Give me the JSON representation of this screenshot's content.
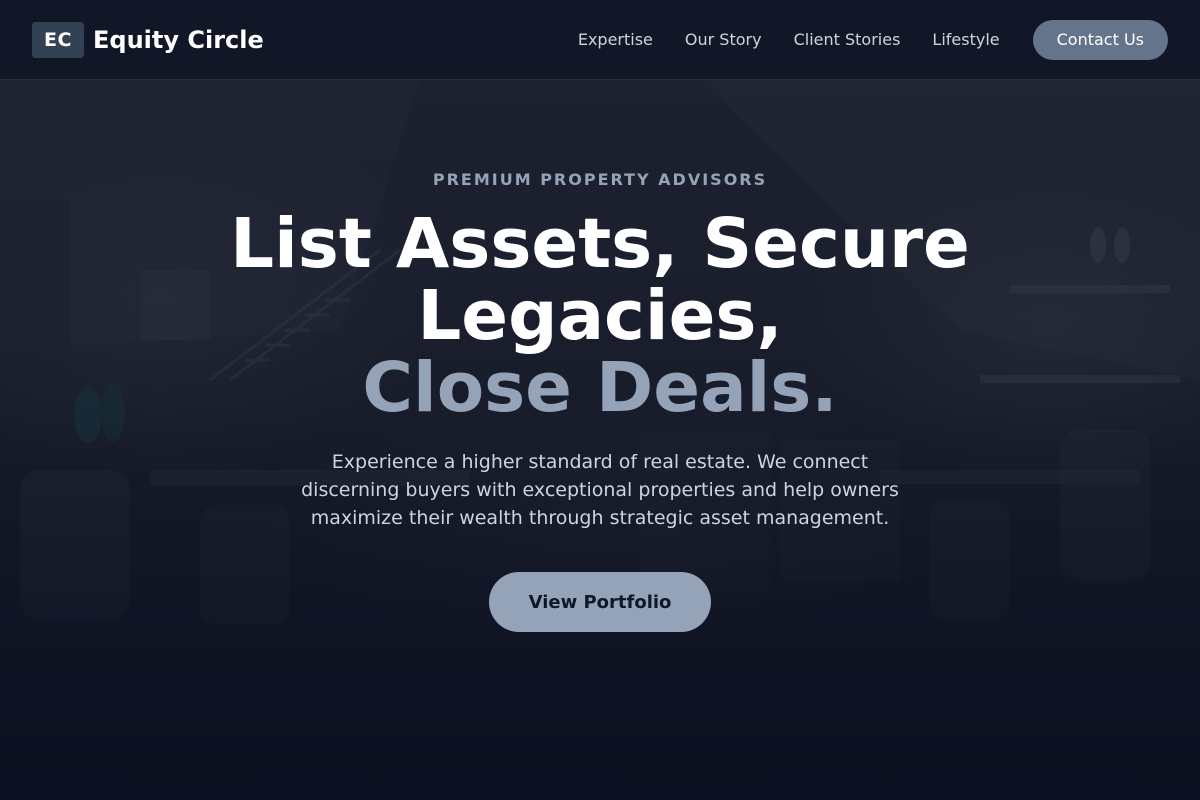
{
  "brand": {
    "badge": "EC",
    "name": "Equity Circle"
  },
  "nav": {
    "links": [
      "Expertise",
      "Our Story",
      "Client Stories",
      "Lifestyle"
    ],
    "contact_label": "Contact Us"
  },
  "hero": {
    "eyebrow": "PREMIUM PROPERTY ADVISORS",
    "headline_line1": "List Assets, Secure",
    "headline_line2": "Legacies,",
    "headline_accent": "Close Deals.",
    "subtext": "Experience a higher standard of real estate. We connect discerning buyers with exceptional properties and help owners maximize their wealth through strategic asset management.",
    "cta_label": "View Portfolio"
  },
  "colors": {
    "page_background": "#0f1424",
    "navbar_background": "#111626",
    "brand_badge": "#334155",
    "contact_button": "#64748b",
    "accent_text": "#94a3b8",
    "cta_button": "#94a3b8",
    "body_text": "#cbd5e1"
  }
}
